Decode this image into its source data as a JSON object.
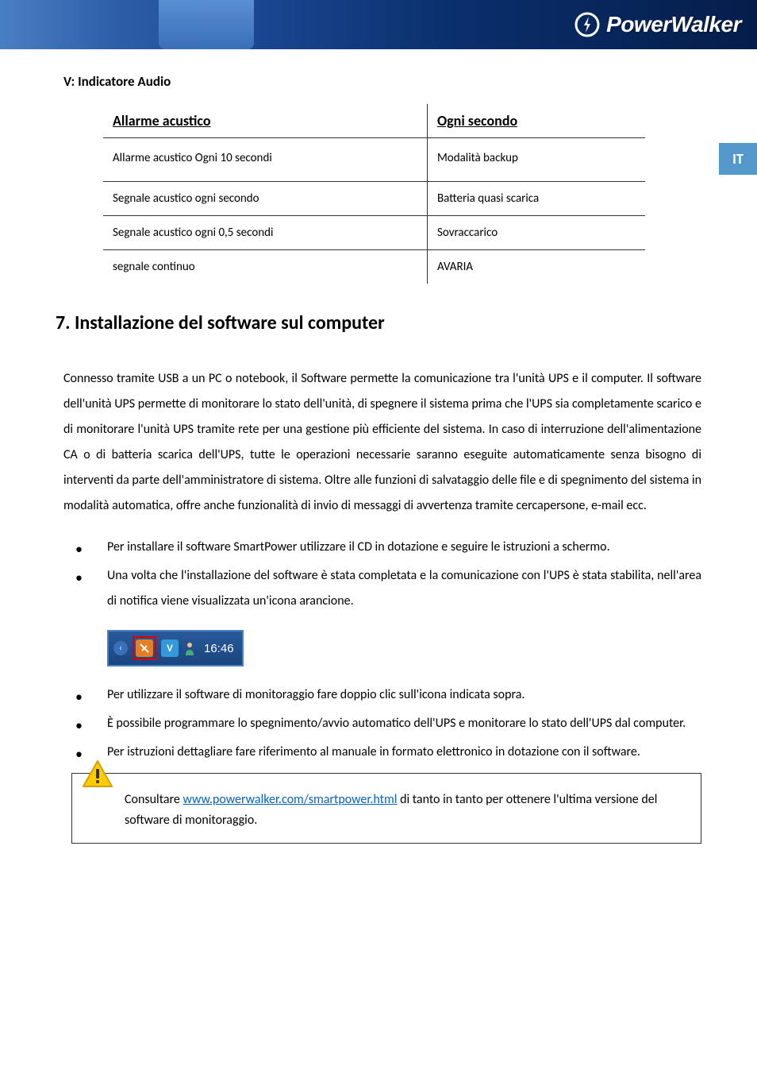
{
  "brand": "PowerWalker",
  "lang_tab": "IT",
  "subsection_title": "V: Indicatore Audio",
  "table": {
    "header_left": "Allarme acustico",
    "header_right": "Ogni secondo",
    "rows": [
      {
        "left": "Allarme acustico Ogni 10 secondi",
        "right": "Modalità backup"
      },
      {
        "left": "Segnale acustico ogni secondo",
        "right": "Batteria quasi scarica"
      },
      {
        "left": "Segnale acustico ogni 0,5 secondi",
        "right": "Sovraccarico"
      },
      {
        "left": "segnale continuo",
        "right": "AVARIA"
      }
    ]
  },
  "section_title": "7. Installazione del software sul computer",
  "body_paragraph": "Connesso tramite USB a un PC o notebook, il Software permette la comunicazione tra l'unità UPS e il computer.  Il software dell'unità UPS permette di monitorare lo stato dell'unità, di spegnere il sistema prima che l'UPS sia completamente scarico e di monitorare l'unità UPS tramite rete per una gestione più efficiente del sistema. In caso di interruzione dell'alimentazione CA o di batteria scarica dell'UPS, tutte le operazioni necessarie saranno eseguite automaticamente senza bisogno di interventi da parte dell'amministratore di sistema. Oltre alle funzioni di salvataggio delle file e di spegnimento del sistema in modalità automatica, offre anche funzionalità di invio di messaggi di avvertenza tramite cercapersone, e-mail ecc.",
  "bullets_top": [
    "Per installare il software SmartPower utilizzare il CD in dotazione e seguire le istruzioni a schermo.",
    "Una volta che l'installazione del software è stata completata e la comunicazione con l'UPS è stata stabilita, nell'area di notifica viene visualizzata un'icona arancione."
  ],
  "tray_time": "16:46",
  "bullets_bottom": [
    "Per utilizzare il software di monitoraggio fare doppio clic sull'icona indicata sopra.",
    "È possibile programmare lo spegnimento/avvio automatico dell'UPS e monitorare lo stato dell'UPS dal computer.",
    "Per istruzioni dettagliare fare riferimento al manuale in formato elettronico in dotazione con il software."
  ],
  "note": {
    "prefix": "Consultare ",
    "link_text": "www.powerwalker.com/smartpower.html",
    "suffix": " di tanto in tanto per ottenere l'ultima versione del software di monitoraggio."
  }
}
